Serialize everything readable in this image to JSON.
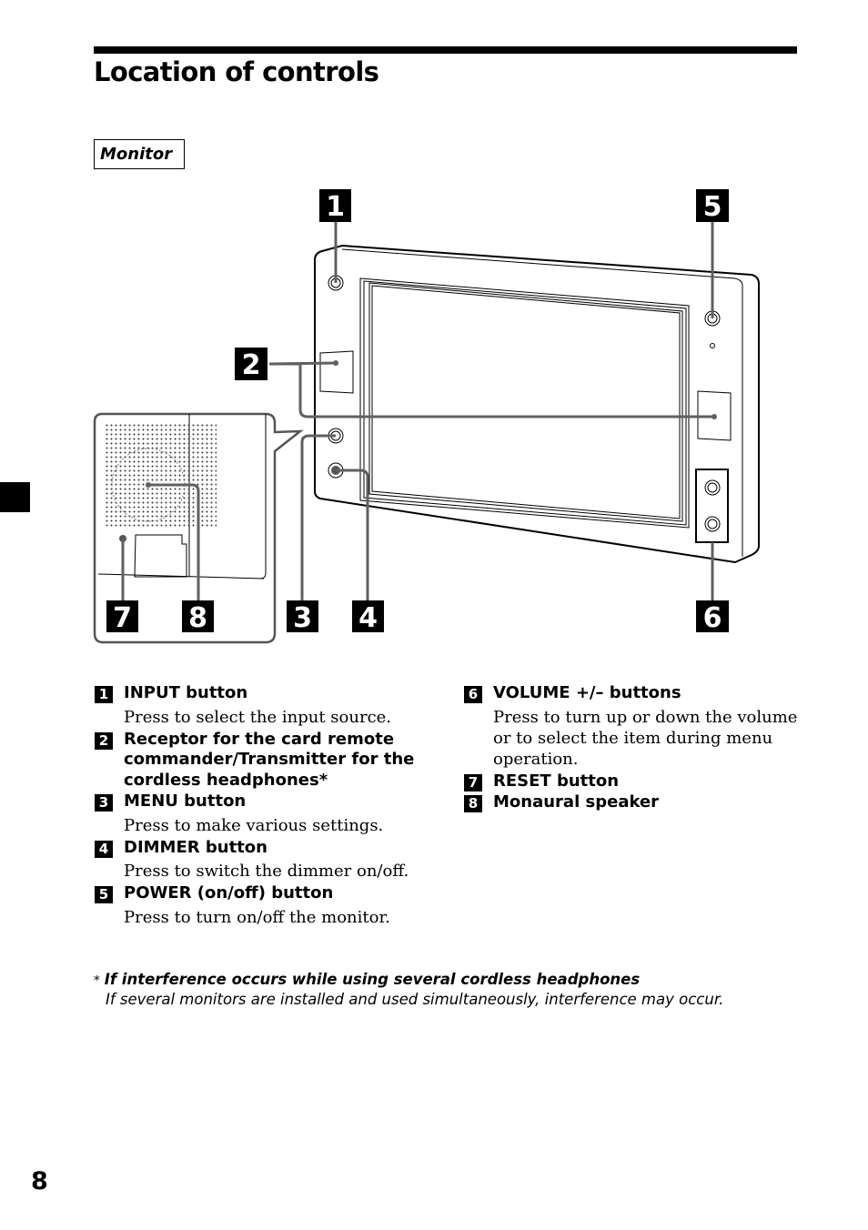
{
  "page": {
    "title": "Location of controls",
    "section_label": "Monitor",
    "page_number": "8"
  },
  "figure": {
    "callouts": [
      "1",
      "2",
      "3",
      "4",
      "5",
      "6",
      "7",
      "8"
    ]
  },
  "controls_left": [
    {
      "num": "1",
      "title": "INPUT button",
      "desc": "Press to select the input source."
    },
    {
      "num": "2",
      "title": "Receptor for the card remote commander/Transmitter for the cordless headphones*",
      "desc": ""
    },
    {
      "num": "3",
      "title": "MENU button",
      "desc": "Press to make various settings."
    },
    {
      "num": "4",
      "title": "DIMMER button",
      "desc": "Press to switch the dimmer on/off."
    },
    {
      "num": "5",
      "title": "POWER (on/off) button",
      "desc": "Press to turn on/off the monitor."
    }
  ],
  "controls_right": [
    {
      "num": "6",
      "title": "VOLUME +/– buttons",
      "desc": "Press to turn up or down the volume or to select the item during menu operation."
    },
    {
      "num": "7",
      "title": "RESET button",
      "desc": ""
    },
    {
      "num": "8",
      "title": "Monaural speaker",
      "desc": ""
    }
  ],
  "footnote": {
    "marker": "*",
    "title": "If interference occurs while using several cordless headphones",
    "text": "If several monitors are installed and used simultaneously, interference may occur."
  }
}
